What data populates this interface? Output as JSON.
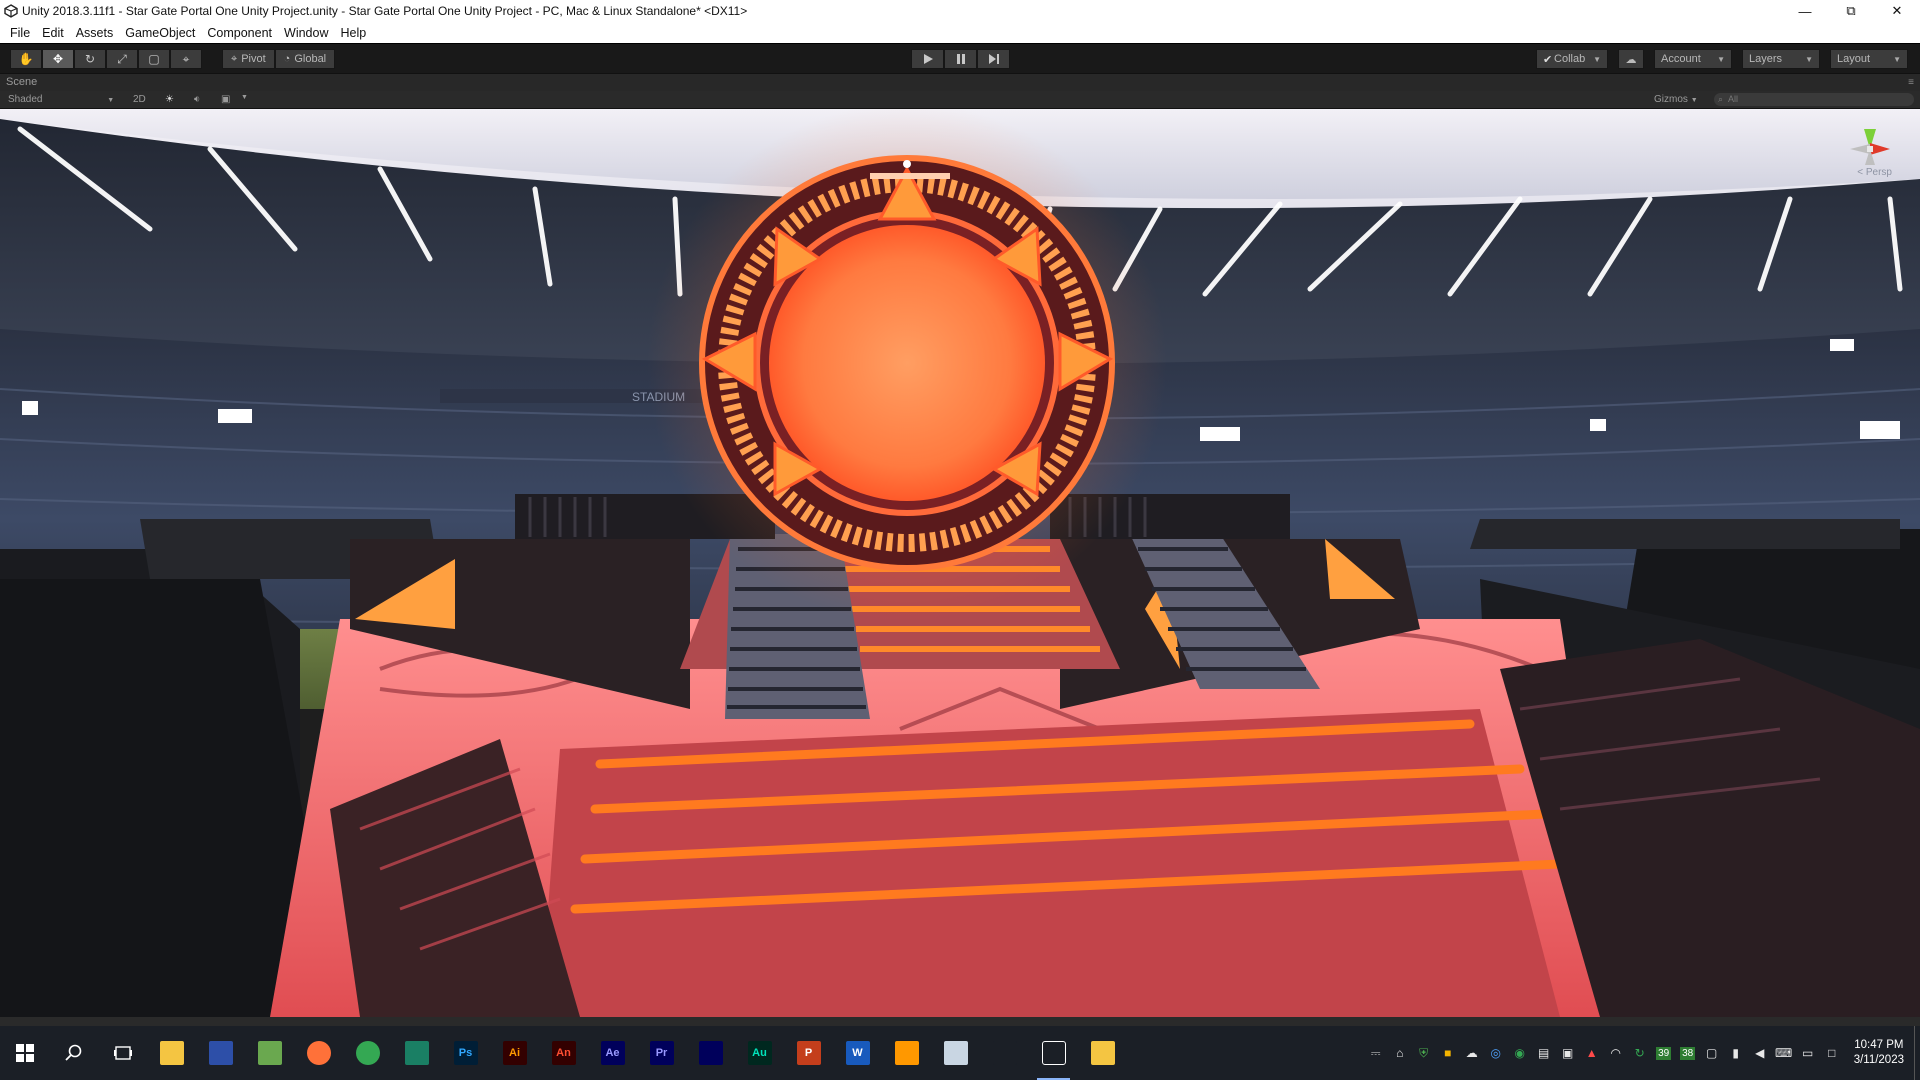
{
  "window": {
    "title": "Unity 2018.3.11f1 - Star Gate Portal One Unity Project.unity - Star Gate Portal One Unity Project - PC, Mac & Linux Standalone* <DX11>",
    "controls": {
      "minimize": "—",
      "restore": "⧉",
      "close": "✕"
    }
  },
  "menu": [
    "File",
    "Edit",
    "Assets",
    "GameObject",
    "Component",
    "Window",
    "Help"
  ],
  "toolbar": {
    "tools": [
      {
        "name": "hand-tool-icon",
        "glyph": "✋"
      },
      {
        "name": "move-tool-icon",
        "glyph": "✥"
      },
      {
        "name": "rotate-tool-icon",
        "glyph": "↻"
      },
      {
        "name": "scale-tool-icon",
        "glyph": "⤢"
      },
      {
        "name": "rect-tool-icon",
        "glyph": "▢"
      },
      {
        "name": "transform-tool-icon",
        "glyph": "⌖"
      }
    ],
    "pivot_label": "Pivot",
    "global_label": "Global",
    "collab_label": "Collab",
    "account_label": "Account",
    "layers_label": "Layers",
    "layout_label": "Layout"
  },
  "scene": {
    "tab_label": "Scene",
    "shading_mode": "Shaded",
    "mode_2d": "2D",
    "gizmos_label": "Gizmos",
    "search_placeholder": "All",
    "persp_label": "< Persp",
    "stadium_sign": "STADIUM"
  },
  "taskbar": {
    "apps": [
      {
        "name": "file-explorer",
        "label": "",
        "color": "#f4c542",
        "fg": "#7a5a00"
      },
      {
        "name": "app-blue-box",
        "label": "",
        "color": "#2d4fa8",
        "fg": "#ffffff"
      },
      {
        "name": "paint-app",
        "label": "",
        "color": "#6aa84f",
        "fg": "#ffffff"
      },
      {
        "name": "firefox",
        "label": "",
        "color": "#ff7139",
        "fg": "#ffffff"
      },
      {
        "name": "chrome",
        "label": "",
        "color": "#34a853",
        "fg": "#ffffff"
      },
      {
        "name": "dreamweaver",
        "label": "",
        "color": "#1a7f64",
        "fg": "#ffffff"
      },
      {
        "name": "photoshop",
        "label": "Ps",
        "color": "#001e36",
        "fg": "#31a8ff"
      },
      {
        "name": "illustrator",
        "label": "Ai",
        "color": "#330000",
        "fg": "#ff9a00"
      },
      {
        "name": "animate",
        "label": "An",
        "color": "#330000",
        "fg": "#ff4e32"
      },
      {
        "name": "after-effects",
        "label": "Ae",
        "color": "#00005b",
        "fg": "#9999ff"
      },
      {
        "name": "premiere",
        "label": "Pr",
        "color": "#00005b",
        "fg": "#9999ff"
      },
      {
        "name": "media-encoder",
        "label": "",
        "color": "#00005b",
        "fg": "#9999ff"
      },
      {
        "name": "audition",
        "label": "Au",
        "color": "#00281f",
        "fg": "#00e4bb"
      },
      {
        "name": "powerpoint",
        "label": "P",
        "color": "#c43e1c",
        "fg": "#ffffff"
      },
      {
        "name": "word",
        "label": "W",
        "color": "#185abd",
        "fg": "#ffffff"
      },
      {
        "name": "sublime",
        "label": "",
        "color": "#ff9800",
        "fg": "#ffffff"
      },
      {
        "name": "notepad",
        "label": "",
        "color": "#c9d6e3",
        "fg": "#333333"
      },
      {
        "name": "app-green-diamond",
        "label": "",
        "color": "#1b1f26",
        "fg": "#ffffff"
      },
      {
        "name": "unity",
        "label": "",
        "color": "#1b1f26",
        "fg": "#ffffff"
      },
      {
        "name": "folder",
        "label": "",
        "color": "#f4c542",
        "fg": "#7a5a00"
      }
    ],
    "tray_numbers": [
      "39",
      "38"
    ],
    "time": "10:47 PM",
    "date": "3/11/2023"
  },
  "colors": {
    "portal_glow": "#ff6a2a",
    "portal_ring": "#ff8a3a",
    "stage": "#ff5a5a",
    "sky": "#e8e6f0",
    "stands": "#3a4560"
  }
}
